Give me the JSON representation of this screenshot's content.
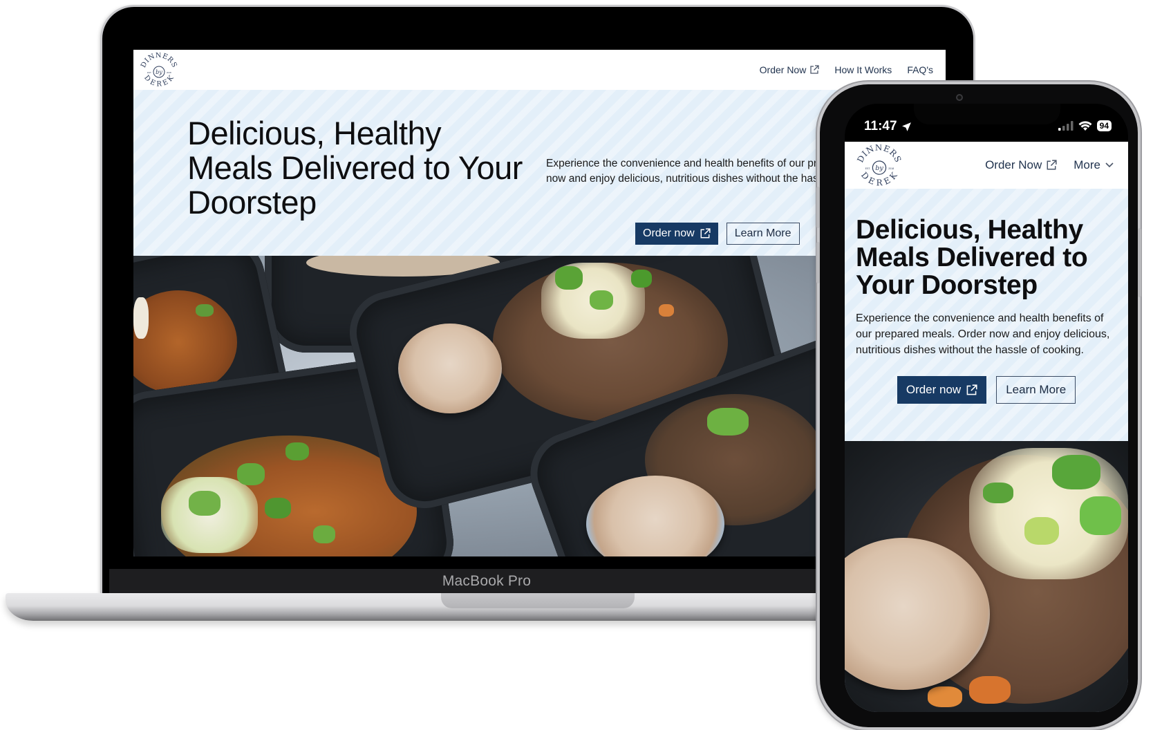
{
  "brand": {
    "name_top": "DINNERS",
    "name_mid": "by",
    "name_bottom": "DEREK",
    "est_left": "EST.",
    "est_right": "2018"
  },
  "colors": {
    "primary": "#173a64",
    "hero_bg": "#e3eff9",
    "nav_text": "#22344f"
  },
  "laptop": {
    "device_label": "MacBook Pro",
    "nav": {
      "links": [
        {
          "label": "Order Now",
          "icon": "external-link-icon"
        },
        {
          "label": "How It Works"
        },
        {
          "label": "FAQ's"
        }
      ]
    },
    "hero": {
      "title": "Delicious, Healthy Meals Delivered to Your Doorstep",
      "description": "Experience the convenience and health benefits of our prepared meals. Order now and enjoy delicious, nutritious dishes without the hassle of cooking.",
      "primary_button": "Order now",
      "secondary_button": "Learn More"
    }
  },
  "phone": {
    "status": {
      "time": "11:47",
      "battery": "94"
    },
    "nav": {
      "order_label": "Order Now",
      "more_label": "More"
    },
    "hero": {
      "title": "Delicious, Healthy Meals Delivered to Your Doorstep",
      "description": "Experience the convenience and health benefits of our prepared meals. Order now and enjoy delicious, nutritious dishes without the hassle of cooking.",
      "primary_button": "Order now",
      "secondary_button": "Learn More"
    }
  }
}
